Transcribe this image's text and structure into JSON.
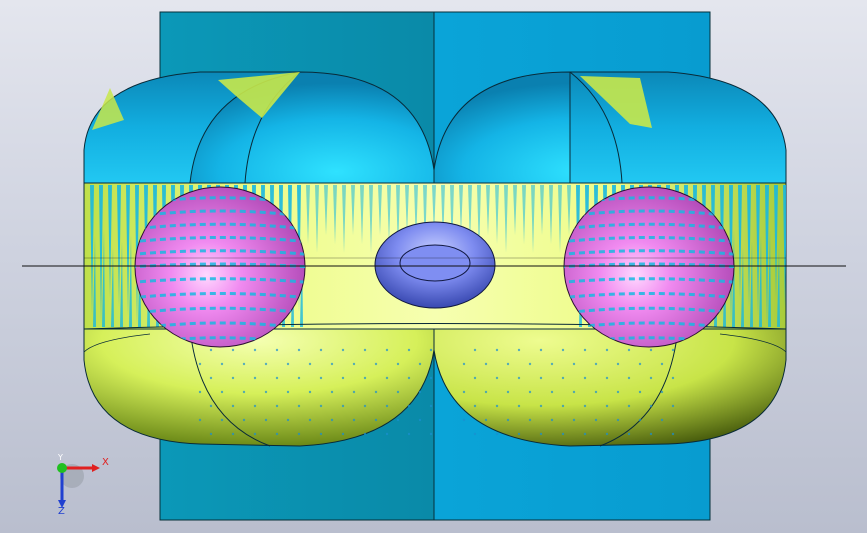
{
  "viewport": {
    "background": "#d6d9e4"
  },
  "model": {
    "name": "",
    "colors": {
      "teal_plate": "#0a93b0",
      "blue_plate": "#0a9fd2",
      "cap_blue": "#16b8e6",
      "yellow_green": "#e8f86a",
      "magenta_sphere": "#e07ee0",
      "violet_torus": "#7d8cee",
      "hatch_cyan": "#18b8e0"
    }
  },
  "triad": {
    "x_label": "X",
    "y_label": "Y",
    "z_label": "Z",
    "colors": {
      "x": "#e02020",
      "y": "#20c020",
      "z": "#2040d0"
    }
  }
}
